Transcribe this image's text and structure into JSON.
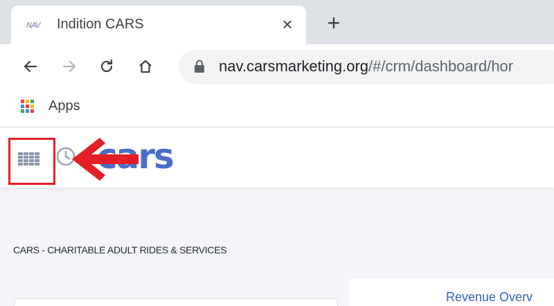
{
  "browser": {
    "tab": {
      "favicon_text": "NAV",
      "title": "Indition CARS",
      "close_glyph": "×"
    },
    "new_tab_glyph": "+",
    "toolbar": {
      "back_icon": "back-arrow-icon",
      "forward_icon": "forward-arrow-icon",
      "reload_icon": "reload-icon",
      "home_icon": "home-icon",
      "lock_icon": "lock-icon",
      "url_host": "nav.carsmarketing.org",
      "url_path": "/#/crm/dashboard/hor"
    },
    "bookmarks": {
      "apps_label": "Apps"
    }
  },
  "app": {
    "logo_text": "cars",
    "menu_icon": "grid-menu-icon",
    "history_icon": "history-icon",
    "org_name": "CARS - CHARITABLE ADULT RIDES & SERVICES",
    "revenue_title": "Revenue Overv"
  },
  "annotation": {
    "highlight_color": "#e41e26",
    "arrow_icon": "red-arrow-icon"
  },
  "colors": {
    "accent": "#4a6ec8",
    "link": "#2f63b8",
    "tabstrip": "#dee1e6",
    "omnibox": "#f1f3f4"
  }
}
